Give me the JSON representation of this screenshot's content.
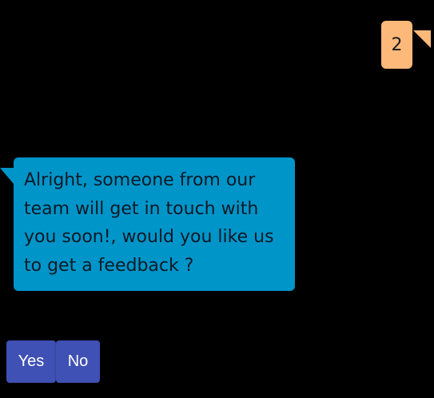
{
  "conversation": {
    "user_message": {
      "text": "2",
      "color": "#fdb97a"
    },
    "bot_message": {
      "text": "Alright, someone from our team will get in touch with you soon!, would you like us to get a feedback ?",
      "color": "#0095c9"
    },
    "quick_replies": [
      {
        "label": "Yes",
        "color": "#3f51b5"
      },
      {
        "label": "No",
        "color": "#3f51b5"
      }
    ]
  }
}
